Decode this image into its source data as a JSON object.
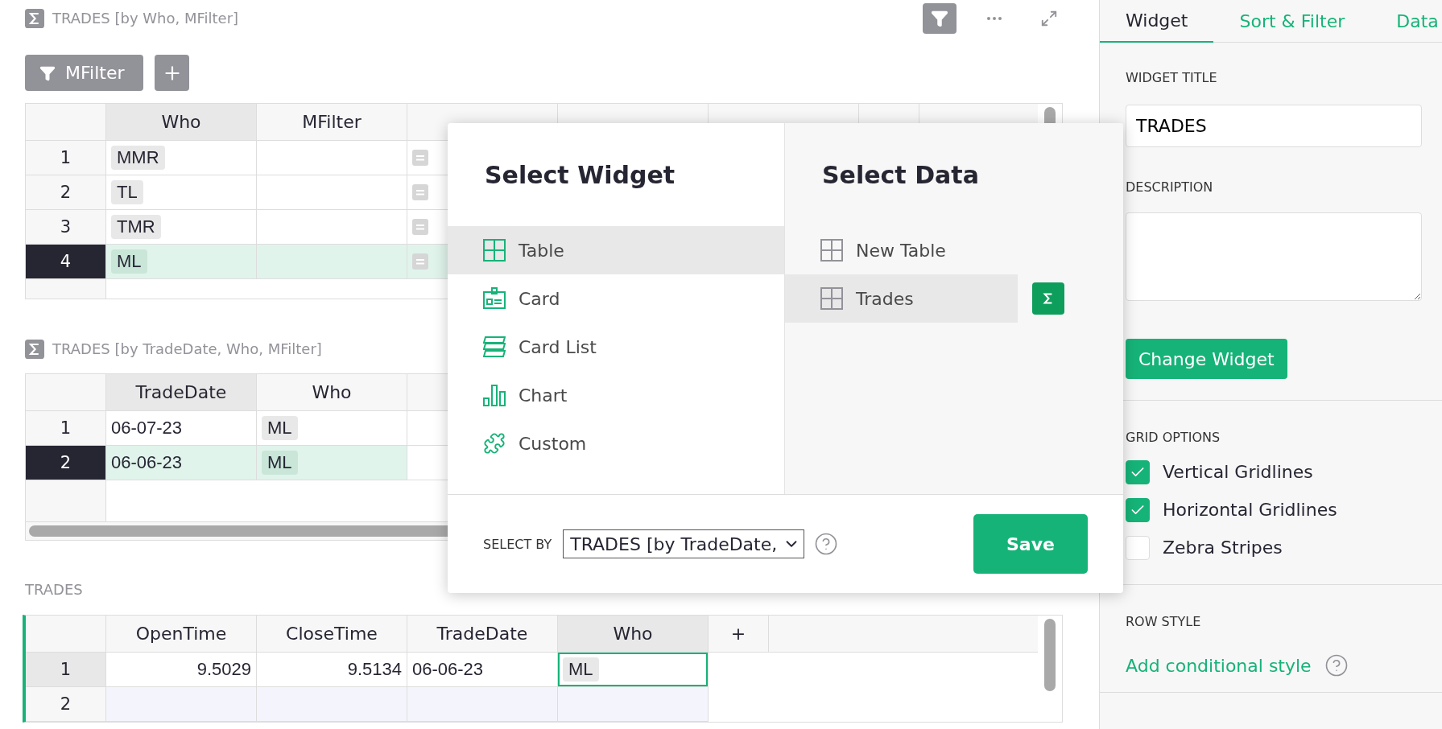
{
  "sections": [
    {
      "title": "TRADES [by Who, MFilter]",
      "summary": true,
      "show_toolbar": true,
      "active": false,
      "filters": [
        {
          "label": "MFilter"
        }
      ],
      "columns": [
        {
          "label": "Who",
          "kind": "field",
          "selected": true
        },
        {
          "label": "MFilter",
          "kind": "field",
          "selected": false
        },
        {
          "kind": "field",
          "selected": false
        },
        {
          "kind": "field",
          "selected": false
        },
        {
          "kind": "field",
          "selected": false
        },
        {
          "kind": "add",
          "selected": false
        }
      ],
      "rows": [
        {
          "number": "1",
          "kind": "record",
          "selected": false,
          "cursor": false,
          "cells": [
            {
              "kind": "chip",
              "text": "MMR"
            },
            {
              "kind": "empty"
            },
            {
              "kind": "formula"
            }
          ]
        },
        {
          "number": "2",
          "kind": "record",
          "selected": false,
          "cursor": false,
          "cells": [
            {
              "kind": "chip",
              "text": "TL"
            },
            {
              "kind": "empty"
            },
            {
              "kind": "formula"
            }
          ]
        },
        {
          "number": "3",
          "kind": "record",
          "selected": false,
          "cursor": false,
          "cells": [
            {
              "kind": "chip",
              "text": "TMR"
            },
            {
              "kind": "empty"
            },
            {
              "kind": "formula"
            }
          ]
        },
        {
          "number": "4",
          "kind": "record",
          "selected": true,
          "cursor": false,
          "cells": [
            {
              "kind": "chip",
              "text": "ML"
            },
            {
              "kind": "empty"
            },
            {
              "kind": "formula"
            }
          ]
        }
      ]
    },
    {
      "title": "TRADES [by TradeDate, Who, MFilter]",
      "summary": true,
      "show_toolbar": false,
      "active": false,
      "columns": [
        {
          "label": "TradeDate",
          "kind": "field",
          "selected": true
        },
        {
          "label": "Who",
          "kind": "field",
          "selected": false
        }
      ],
      "rows": [
        {
          "number": "1",
          "kind": "record",
          "selected": false,
          "cursor": false,
          "cells": [
            {
              "kind": "text",
              "text": "06-07-23"
            },
            {
              "kind": "chip",
              "text": "ML"
            }
          ]
        },
        {
          "number": "2",
          "kind": "record",
          "selected": true,
          "cursor": false,
          "cells": [
            {
              "kind": "text",
              "text": "06-06-23"
            },
            {
              "kind": "chip",
              "text": "ML"
            }
          ]
        }
      ]
    },
    {
      "title": "TRADES",
      "summary": false,
      "show_toolbar": false,
      "active": true,
      "columns": [
        {
          "label": "OpenTime",
          "kind": "field",
          "selected": false
        },
        {
          "label": "CloseTime",
          "kind": "field",
          "selected": false
        },
        {
          "label": "TradeDate",
          "kind": "field",
          "selected": false
        },
        {
          "label": "Who",
          "kind": "field",
          "selected": true
        },
        {
          "label": "+",
          "kind": "add",
          "selected": false
        }
      ],
      "rows": [
        {
          "number": "1",
          "kind": "record",
          "selected": false,
          "cursor": true,
          "cells": [
            {
              "kind": "number",
              "text": "9.5029",
              "active": false
            },
            {
              "kind": "number",
              "text": "9.5134",
              "active": false
            },
            {
              "kind": "text",
              "text": "06-06-23",
              "active": false
            },
            {
              "kind": "chip",
              "text": "ML",
              "active": true
            }
          ]
        },
        {
          "number": "2",
          "kind": "add",
          "selected": false,
          "cursor": false,
          "cells": [
            {
              "kind": "empty",
              "active": false
            },
            {
              "kind": "empty",
              "active": false
            },
            {
              "kind": "empty",
              "active": false
            },
            {
              "kind": "empty",
              "active": false
            }
          ]
        }
      ]
    }
  ],
  "popup": {
    "widget_title": "Select Widget",
    "widgets": [
      {
        "label": "Table",
        "selected": true
      },
      {
        "label": "Card",
        "selected": false
      },
      {
        "label": "Card List",
        "selected": false
      },
      {
        "label": "Chart",
        "selected": false
      },
      {
        "label": "Custom",
        "selected": false
      }
    ],
    "data_title": "Select Data",
    "data": [
      {
        "label": "New Table",
        "selected": false,
        "summary": false
      },
      {
        "label": "Trades",
        "selected": true,
        "summary": true
      }
    ],
    "select_by_label": "SELECT BY",
    "select_by_value": "TRADES [by TradeDate,",
    "save": "Save"
  },
  "panel": {
    "tabs": [
      {
        "label": "Widget",
        "selected": true
      },
      {
        "label": "Sort & Filter",
        "selected": false
      },
      {
        "label": "Data",
        "selected": false
      }
    ],
    "title_label": "WIDGET TITLE",
    "title_value": "TRADES",
    "description_label": "DESCRIPTION",
    "change_button": "Change Widget",
    "grid_label": "GRID OPTIONS",
    "grid_options": [
      {
        "label": "Vertical Gridlines",
        "checked": true
      },
      {
        "label": "Horizontal Gridlines",
        "checked": true
      },
      {
        "label": "Zebra Stripes",
        "checked": false
      }
    ],
    "row_style_label": "ROW STYLE",
    "conditional_link": "Add conditional style"
  }
}
